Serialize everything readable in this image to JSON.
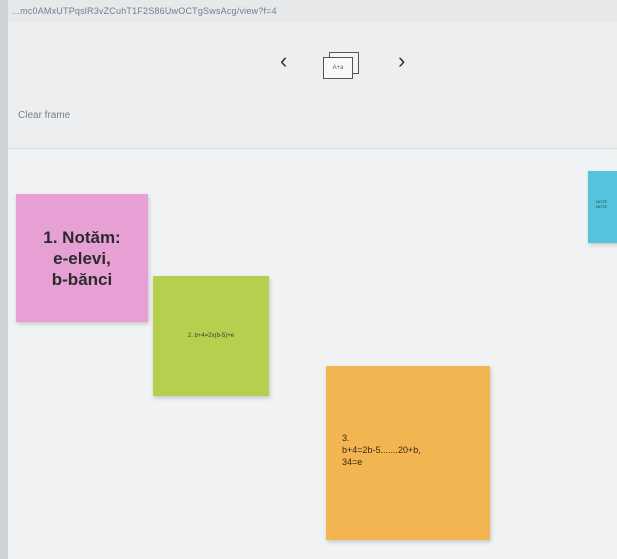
{
  "url": "...mc0AMxUTPqslR3vZCuhT1F2S86UwOCTgSwsAcg/view?f=4",
  "toolbar": {
    "prev_icon": "chevron-left-icon",
    "prev_glyph": "‹",
    "next_icon": "chevron-right-icon",
    "next_glyph": "›",
    "slides_icon": "slides-icon",
    "slides_label": "A+a"
  },
  "page_label": "Clear frame",
  "notes": [
    {
      "text": "1. Notăm:\ne-elevi,\nb-bănci",
      "color": "#e6a0d4"
    },
    {
      "text": "2. b+4=2x(b-5)+e",
      "color": "#b7cf4f"
    },
    {
      "text": "3.\nb+4=2b-5.......20+b,\n34=e",
      "color": "#f2b552"
    },
    {
      "text": "NOTE\nNOTE",
      "color": "#54c4dc"
    }
  ]
}
